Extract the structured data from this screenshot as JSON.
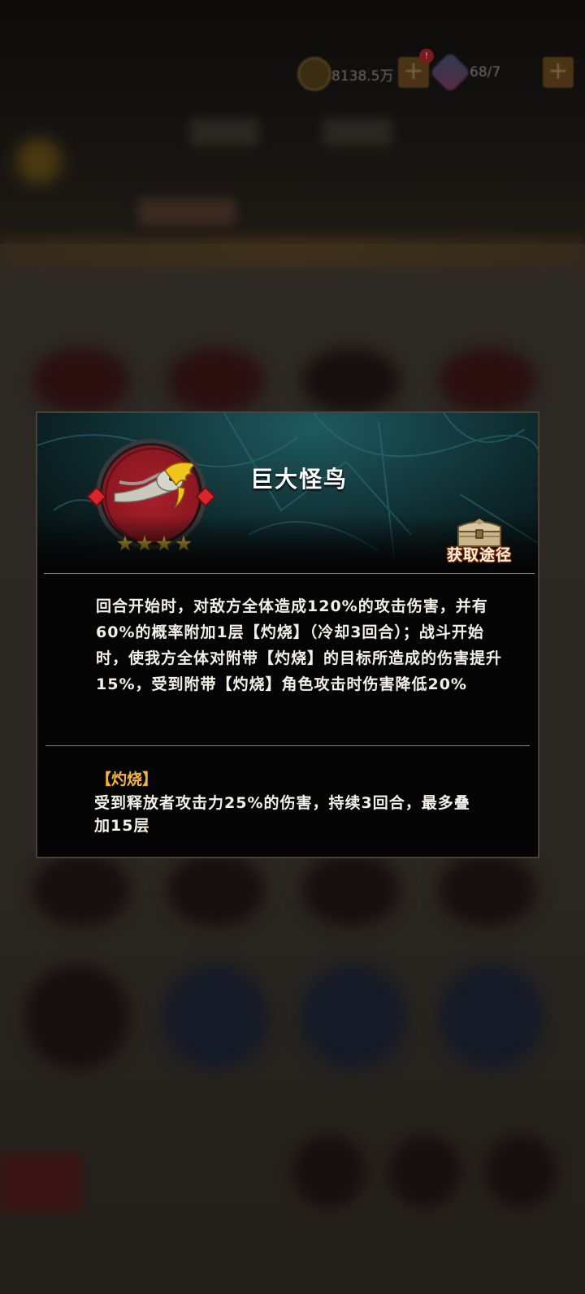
{
  "hud": {
    "coins": "8138.5万",
    "plus_label": "+",
    "notify_badge": "!",
    "gems": "68/7"
  },
  "skill_dialog": {
    "name": "巨大怪鸟",
    "star_count": 4,
    "star_glyph": "★",
    "obtain_label": "获取途径",
    "description": "回合开始时，对敌方全体造成120%的攻击伤害，并有60%的概率附加1层【灼烧】（冷却3回合）；战斗开始时，使我方全体对附带【灼烧】的目标所造成的伤害提升15%，受到附带【灼烧】角色攻击时伤害降低20%",
    "term_title": "【灼烧】",
    "term_description": "受到释放者攻击力25%的伤害，持续3回合，最多叠加15层"
  },
  "colors": {
    "term_accent": "#f2b43c",
    "star": "#ffd43b",
    "portrait_bg": "#a8202a",
    "header_teal": "#1f5a5e"
  }
}
